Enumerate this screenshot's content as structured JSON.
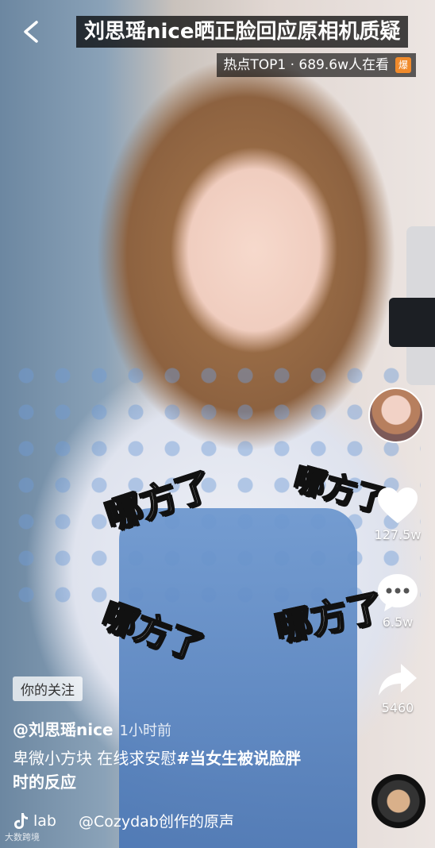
{
  "top_bar": {
    "back_icon": "chevron-left-icon",
    "title": "刘思瑶nice晒正脸回应原相机质疑",
    "hot_label": "热点TOP1 · 689.6w人在看",
    "hot_badge": "爆"
  },
  "stickers": [
    "哪方了",
    "哪方了",
    "哪方了",
    "哪方了"
  ],
  "right_rail": {
    "like_count": "127.5w",
    "comment_count": "6.5w",
    "share_count": "5460"
  },
  "info": {
    "follow_tag": "你的关注",
    "author": "@刘思瑶nice",
    "time": "1小时前",
    "desc_text": "卑微小方块 在线求安慰",
    "desc_tag": "#当女生被说脸胖时的反应",
    "music_prefix": "lab",
    "music_source": "@Cozydab创作的原声"
  },
  "watermark": "大数跨境"
}
